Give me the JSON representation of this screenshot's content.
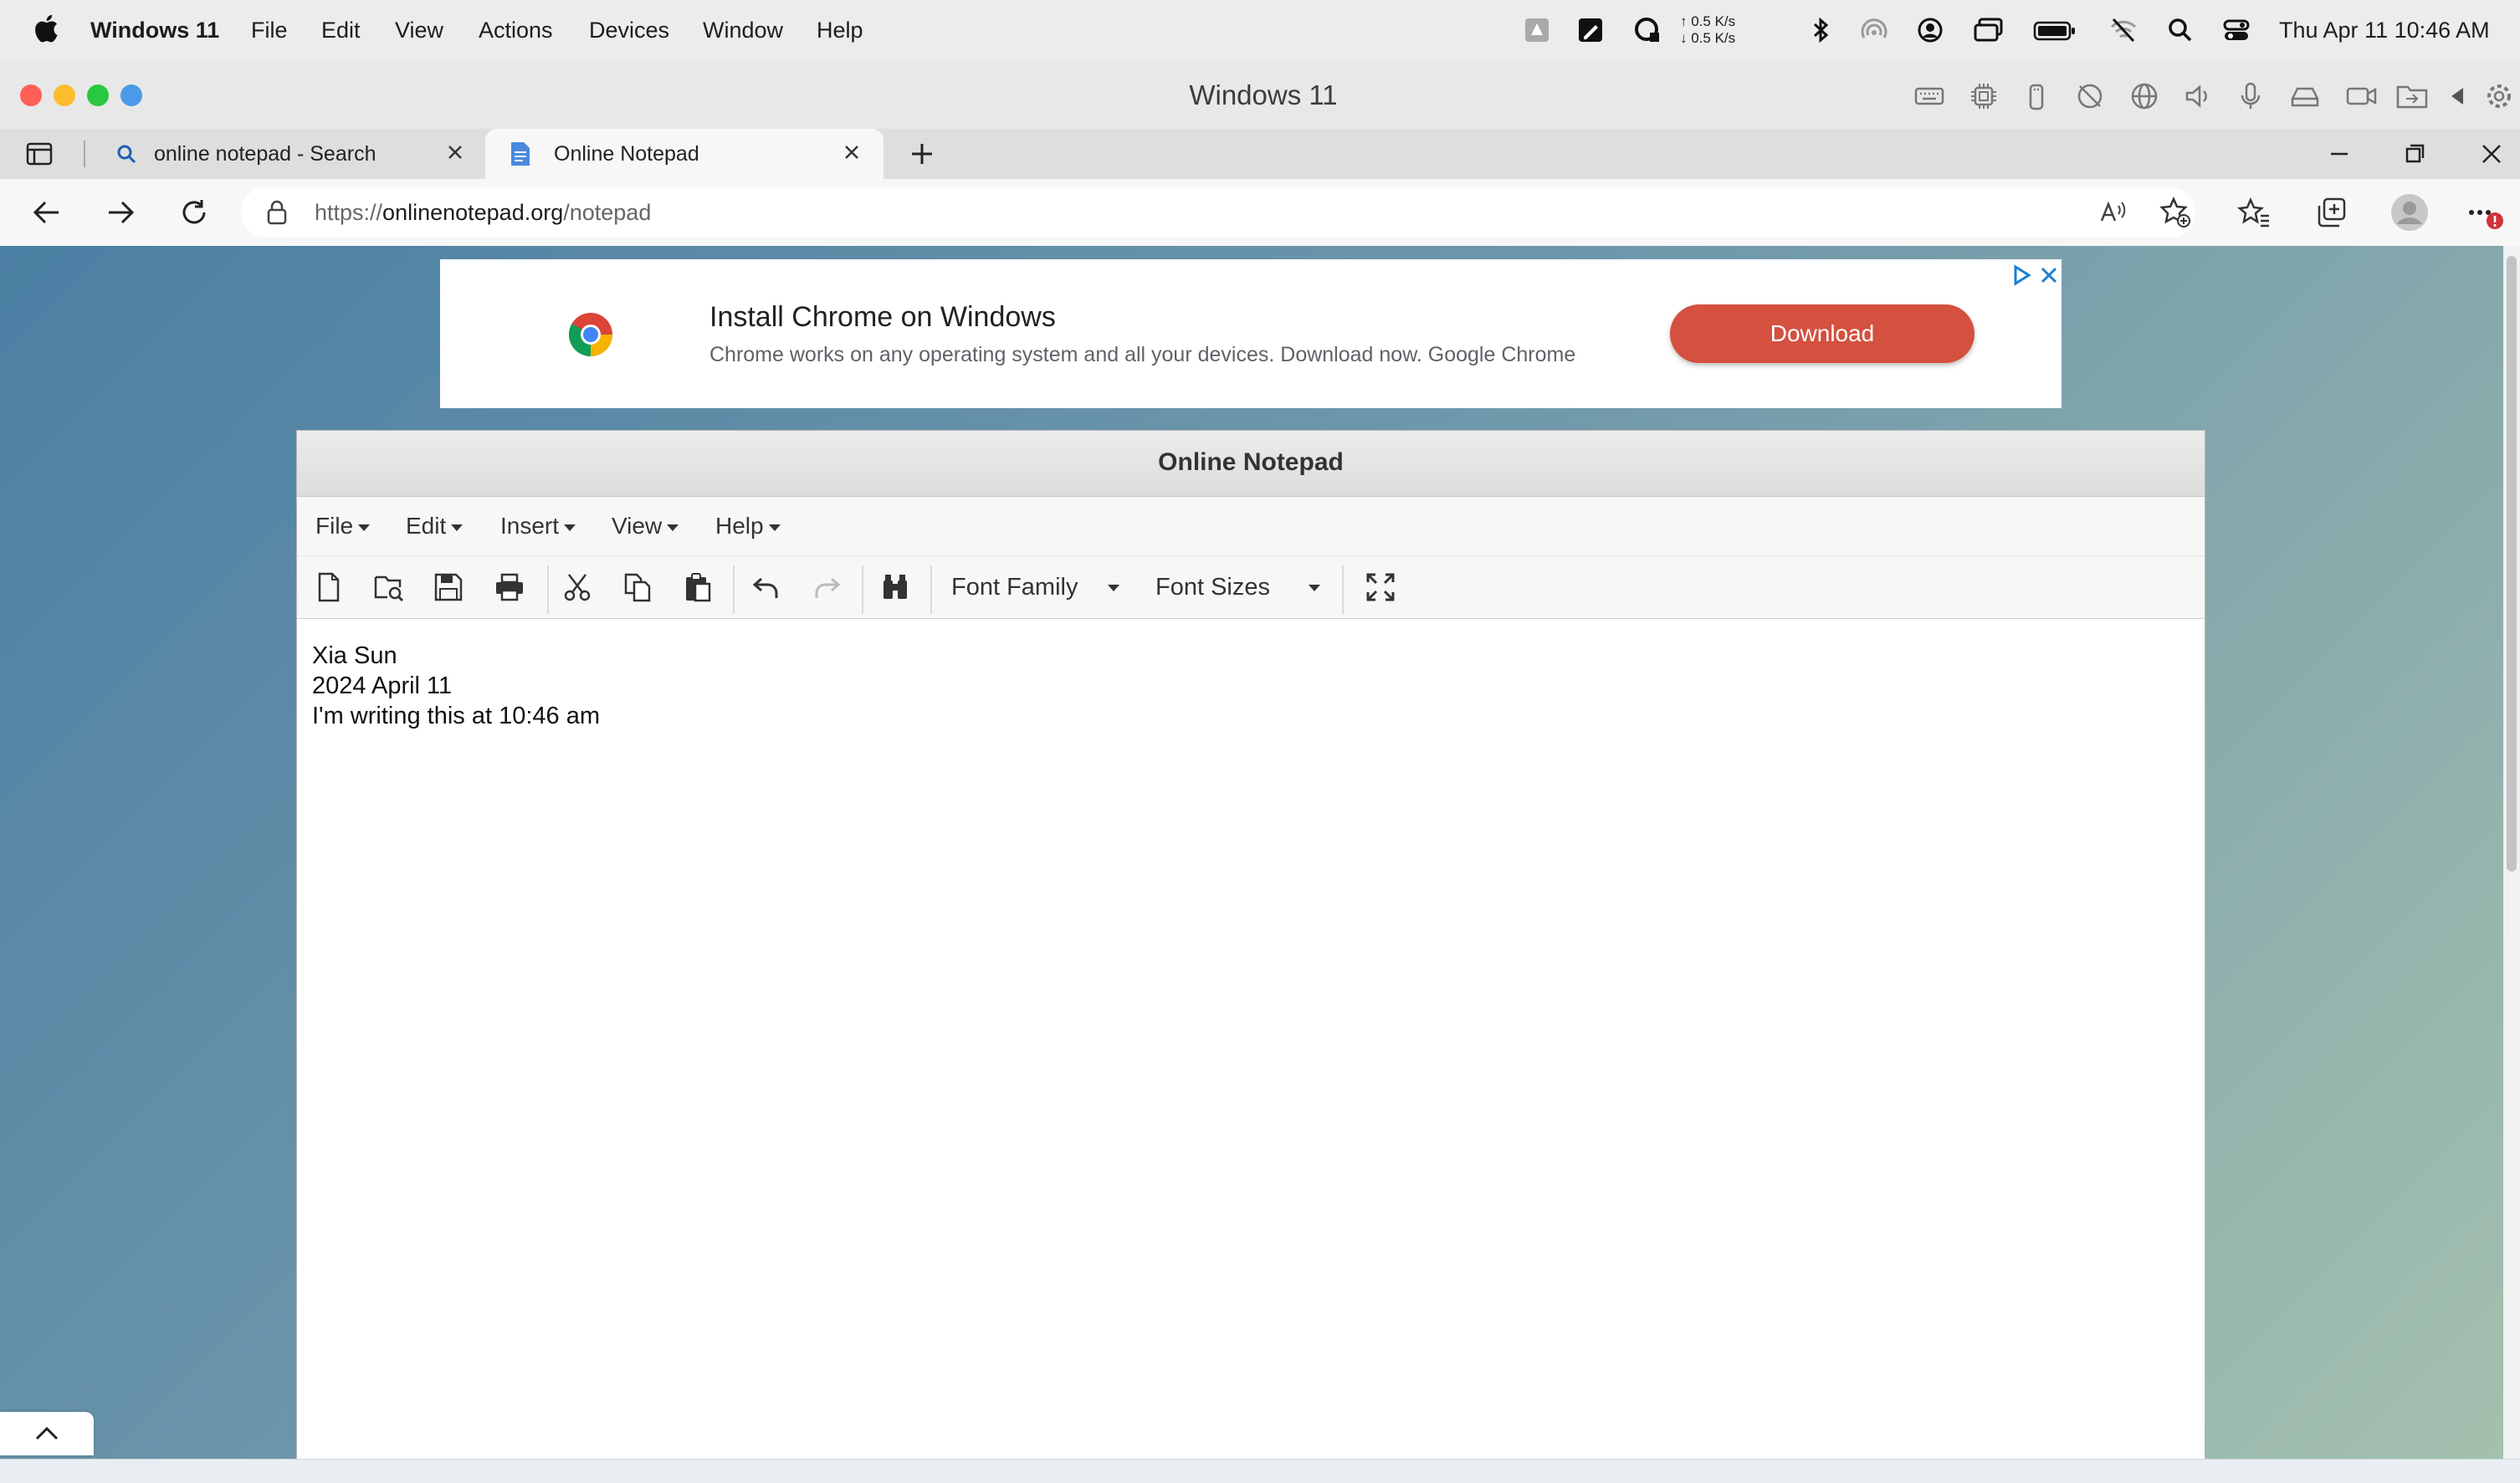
{
  "mac_menubar": {
    "app_name": "Windows 11",
    "menus": [
      "File",
      "Edit",
      "View",
      "Actions",
      "Devices",
      "Window",
      "Help"
    ],
    "net_up": "0.5 K/s",
    "net_down": "0.5 K/s",
    "clock": "Thu Apr 11  10:46 AM"
  },
  "vm_window": {
    "title": "Windows 11"
  },
  "browser": {
    "tabs": [
      {
        "label": "online notepad - Search",
        "icon": "search-icon",
        "active": false
      },
      {
        "label": "Online Notepad",
        "icon": "document-icon",
        "active": true
      }
    ],
    "url_scheme": "https://",
    "url_host": "onlinenotepad.org",
    "url_path": "/notepad"
  },
  "ad": {
    "title": "Install Chrome on Windows",
    "subtitle": "Chrome works on any operating system and all your devices. Download now. Google Chrome",
    "button": "Download"
  },
  "notepad": {
    "title": "Online Notepad",
    "menus": [
      "File",
      "Edit",
      "Insert",
      "View",
      "Help"
    ],
    "font_family_label": "Font Family",
    "font_sizes_label": "Font Sizes",
    "lines": [
      "Xia Sun",
      "2024 April 11",
      "I'm writing this at 10:46 am"
    ]
  },
  "colors": {
    "ad_button": "#d4503f",
    "close_red": "#ff5f57",
    "minimize_yellow": "#febc2e",
    "zoom_green": "#28c840",
    "notification_badge": "#d13438"
  }
}
